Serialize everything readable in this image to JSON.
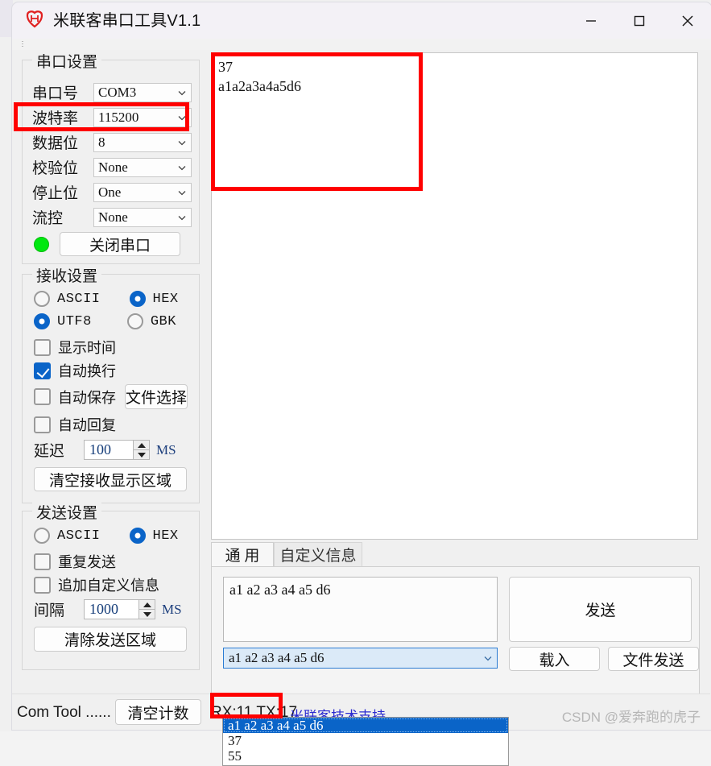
{
  "window": {
    "title": "米联客串口工具V1.1",
    "logo_icon": "app-logo-icon",
    "minimize_label": "—",
    "maximize_label": "□",
    "close_label": "✕"
  },
  "serial_settings": {
    "title": "串口设置",
    "fields": [
      {
        "label": "串口号",
        "value": "COM3"
      },
      {
        "label": "波特率",
        "value": "115200"
      },
      {
        "label": "数据位",
        "value": "8"
      },
      {
        "label": "校验位",
        "value": "None"
      },
      {
        "label": "停止位",
        "value": "One"
      },
      {
        "label": "流控",
        "value": "None"
      }
    ],
    "port_button": "关闭串口",
    "led_color": "#00e810",
    "highlight_color": "#ff0000"
  },
  "receive_settings": {
    "title": "接收设置",
    "encoding_radios": [
      {
        "label": "ASCII",
        "checked": false
      },
      {
        "label": "HEX",
        "checked": true
      },
      {
        "label": "UTF8",
        "checked": true
      },
      {
        "label": "GBK",
        "checked": false
      }
    ],
    "checkboxes": [
      {
        "label": "显示时间",
        "checked": false
      },
      {
        "label": "自动换行",
        "checked": true
      },
      {
        "label": "自动保存",
        "checked": false
      },
      {
        "label": "自动回复",
        "checked": false
      }
    ],
    "file_select_button": "文件选择",
    "delay_label": "延迟",
    "delay_value": "100",
    "delay_unit": "MS",
    "clear_button": "清空接收显示区域"
  },
  "send_settings": {
    "title": "发送设置",
    "format_radios": [
      {
        "label": "ASCII",
        "checked": false
      },
      {
        "label": "HEX",
        "checked": true
      }
    ],
    "checkboxes": [
      {
        "label": "重复发送",
        "checked": false
      },
      {
        "label": "追加自定义信息",
        "checked": false
      }
    ],
    "interval_label": "间隔",
    "interval_value": "1000",
    "interval_unit": "MS",
    "clear_button": "清除发送区域"
  },
  "receive_area": {
    "lines": [
      "37",
      "a1a2a3a4a5d6"
    ],
    "text": "37\na1a2a3a4a5d6"
  },
  "send_area": {
    "tabs": [
      {
        "label": "通  用",
        "active": true
      },
      {
        "label": "自定义信息",
        "active": false
      }
    ],
    "input_value": "a1 a2 a3 a4 a5 d6",
    "send_button": "发送",
    "history_value": "a1 a2 a3 a4 a5 d6",
    "history_options": [
      {
        "label": "a1 a2 a3 a4 a5 d6",
        "selected": true
      },
      {
        "label": "37",
        "selected": false
      },
      {
        "label": "55",
        "selected": false
      }
    ],
    "load_button": "载入",
    "file_send_button": "文件发送"
  },
  "status_bar": {
    "text": "Com Tool ......",
    "clear_count_button": "清空计数",
    "counters": "RX:11  TX:17",
    "link_text": "米联客技术支持"
  },
  "watermark": "CSDN @爱奔跑的虎子"
}
